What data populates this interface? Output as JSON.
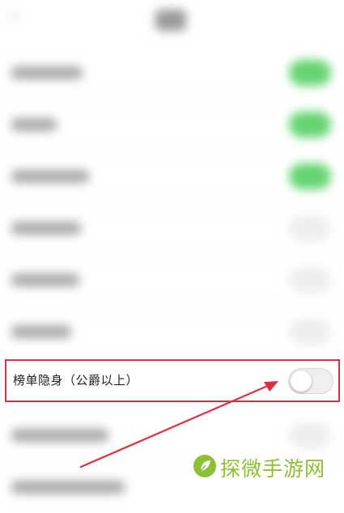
{
  "highlighted_setting": {
    "label": "榜单隐身（公爵以上）",
    "toggle_state": "off"
  },
  "blurred_settings": [
    {
      "toggle_state": "on"
    },
    {
      "toggle_state": "on"
    },
    {
      "toggle_state": "on"
    },
    {
      "toggle_state": "off"
    },
    {
      "toggle_state": "off"
    },
    {
      "toggle_state": "off"
    },
    {
      "toggle_state": "off"
    }
  ],
  "watermark": {
    "text": "探微手游网"
  },
  "colors": {
    "highlight_border": "#d9303f",
    "toggle_on": "#64d471",
    "watermark": "#8ebf36"
  }
}
